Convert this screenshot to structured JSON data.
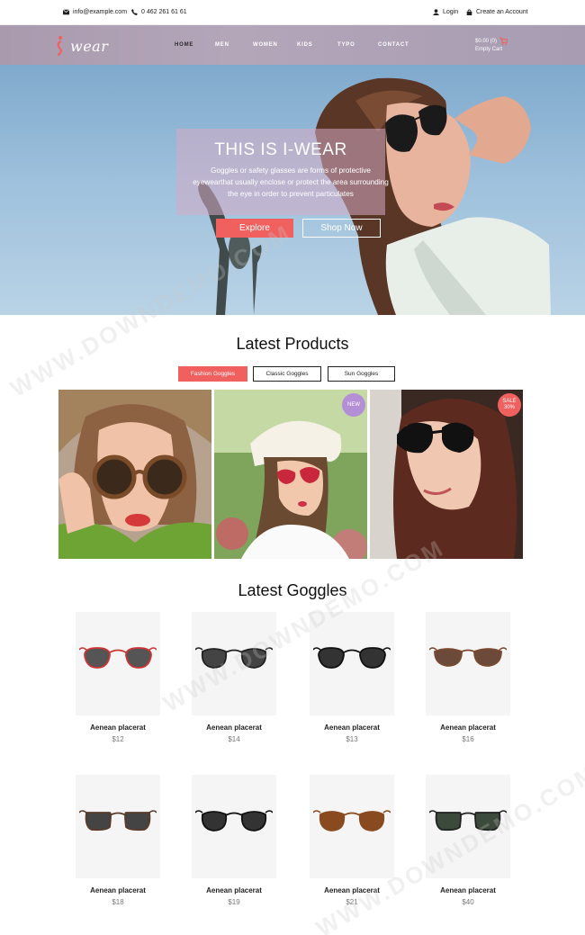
{
  "topbar": {
    "email": "info@example.com",
    "phone": "0 462 261 61 61",
    "login": "Login",
    "create_account": "Create an Account"
  },
  "header": {
    "logo_text": "wear",
    "nav": [
      "HOME",
      "MEN",
      "WOMEN",
      "KIDS",
      "TYPO",
      "CONTACT"
    ],
    "active_nav": "HOME",
    "cart_amount": "$0.00 (0)",
    "cart_status": "Empty Cart"
  },
  "hero": {
    "title": "THIS IS I-WEAR",
    "text": "Goggles or safety glasses are forms of protective eyewearthat usually enclose or protect the area surrounding the eye in order to prevent particulates",
    "explore_label": "Explore",
    "shop_label": "Shop Now"
  },
  "latest_products": {
    "title": "Latest Products",
    "filters": [
      "Fashion Goggles",
      "Classic Goggles",
      "Sun Goggles"
    ],
    "active_filter": "Fashion Goggles",
    "badge_new": "NEW",
    "badge_sale": "SALE",
    "badge_sale_pct": "30%"
  },
  "latest_goggles": {
    "title": "Latest Goggles",
    "products": [
      {
        "name": "Aenean placerat",
        "price": "$12"
      },
      {
        "name": "Aenean placerat",
        "price": "$14"
      },
      {
        "name": "Aenean placerat",
        "price": "$13"
      },
      {
        "name": "Aenean placerat",
        "price": "$16"
      },
      {
        "name": "Aenean placerat",
        "price": "$18"
      },
      {
        "name": "Aenean placerat",
        "price": "$19"
      },
      {
        "name": "Aenean placerat",
        "price": "$21"
      },
      {
        "name": "Aenean placerat",
        "price": "$40"
      }
    ]
  },
  "watermark": "WWW.DOWNDEMO.COM",
  "colors": {
    "accent": "#f0605f",
    "header_bg": "#a99aae",
    "badge_new": "#b58fd6",
    "badge_sale": "#f0605f"
  },
  "icons": [
    "mail-icon",
    "phone-icon",
    "user-icon",
    "lock-icon",
    "cart-icon"
  ]
}
